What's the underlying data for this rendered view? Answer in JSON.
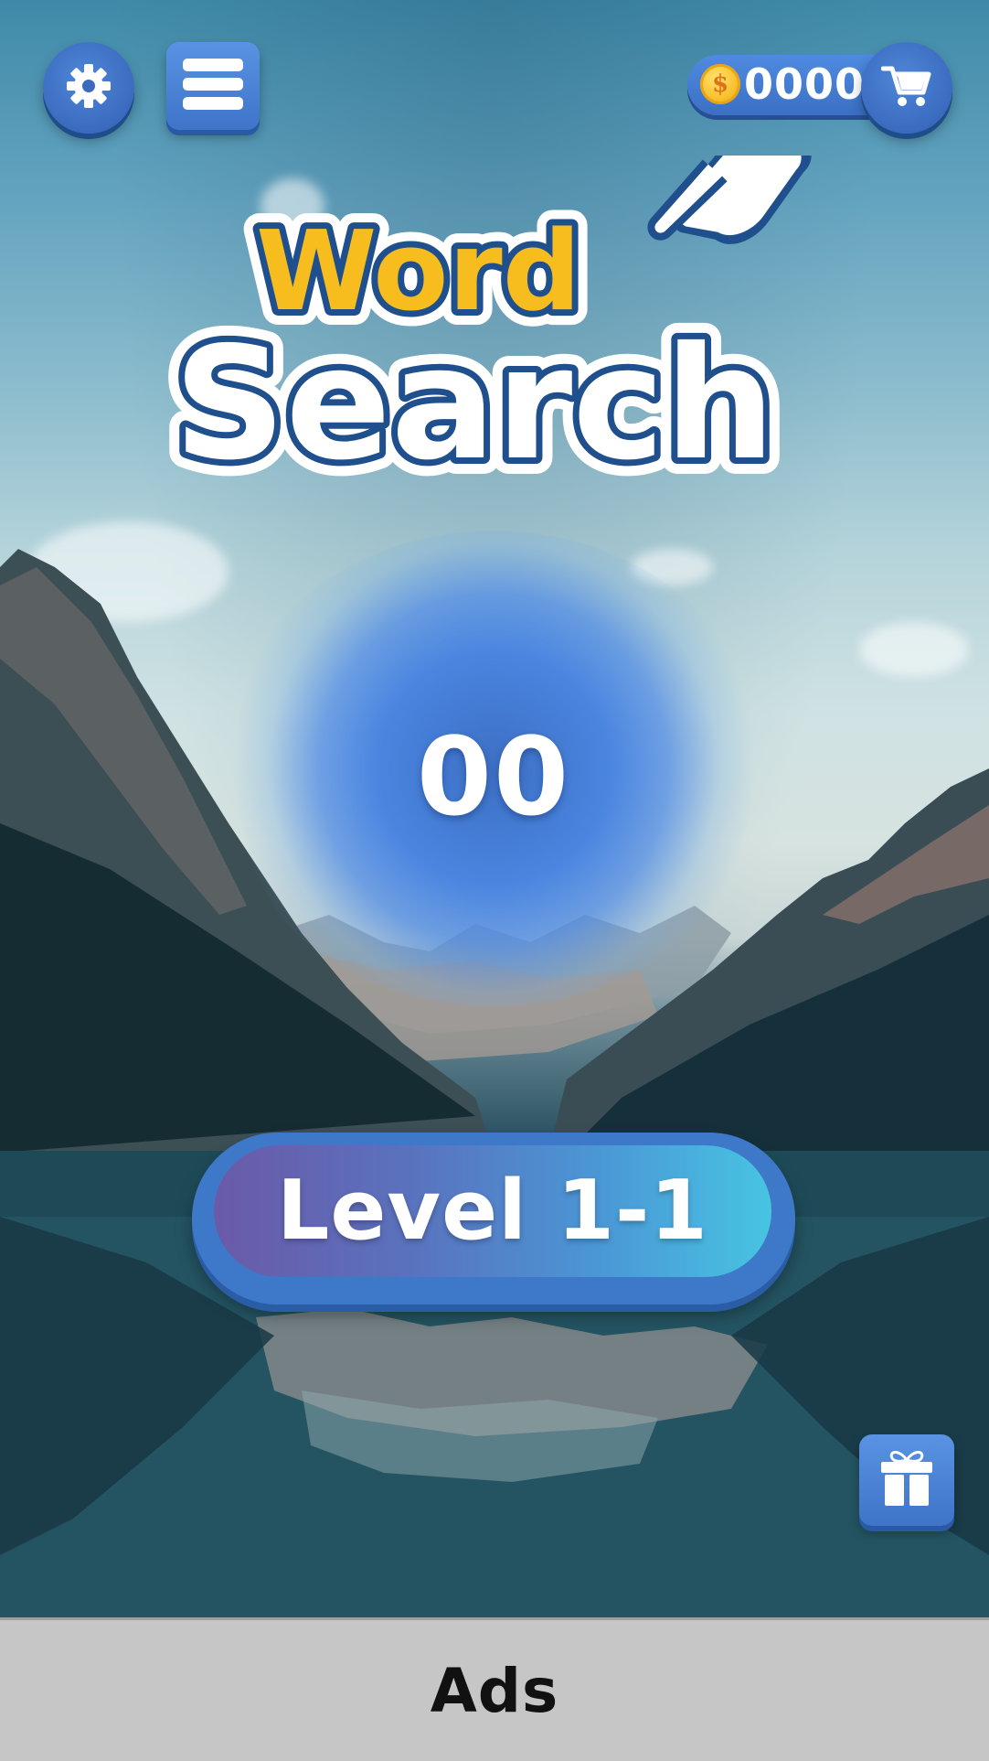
{
  "header": {
    "settings_icon": "gear-icon",
    "menu_icon": "hamburger-icon",
    "coins": "0000",
    "coin_icon": "coin-icon",
    "shop_icon": "cart-icon"
  },
  "logo": {
    "line1": "Word",
    "line2": "Search",
    "icon": "pointing-hand-icon"
  },
  "main": {
    "score": "00",
    "level_button": "Level 1-1"
  },
  "bonus": {
    "gift_icon": "gift-icon"
  },
  "footer": {
    "ads_label": "Ads"
  },
  "colors": {
    "primary_blue": "#3d79c8",
    "logo_yellow": "#f7bd1f",
    "logo_navy": "#1f4f8c",
    "ads_bar": "#c6c6c6"
  }
}
